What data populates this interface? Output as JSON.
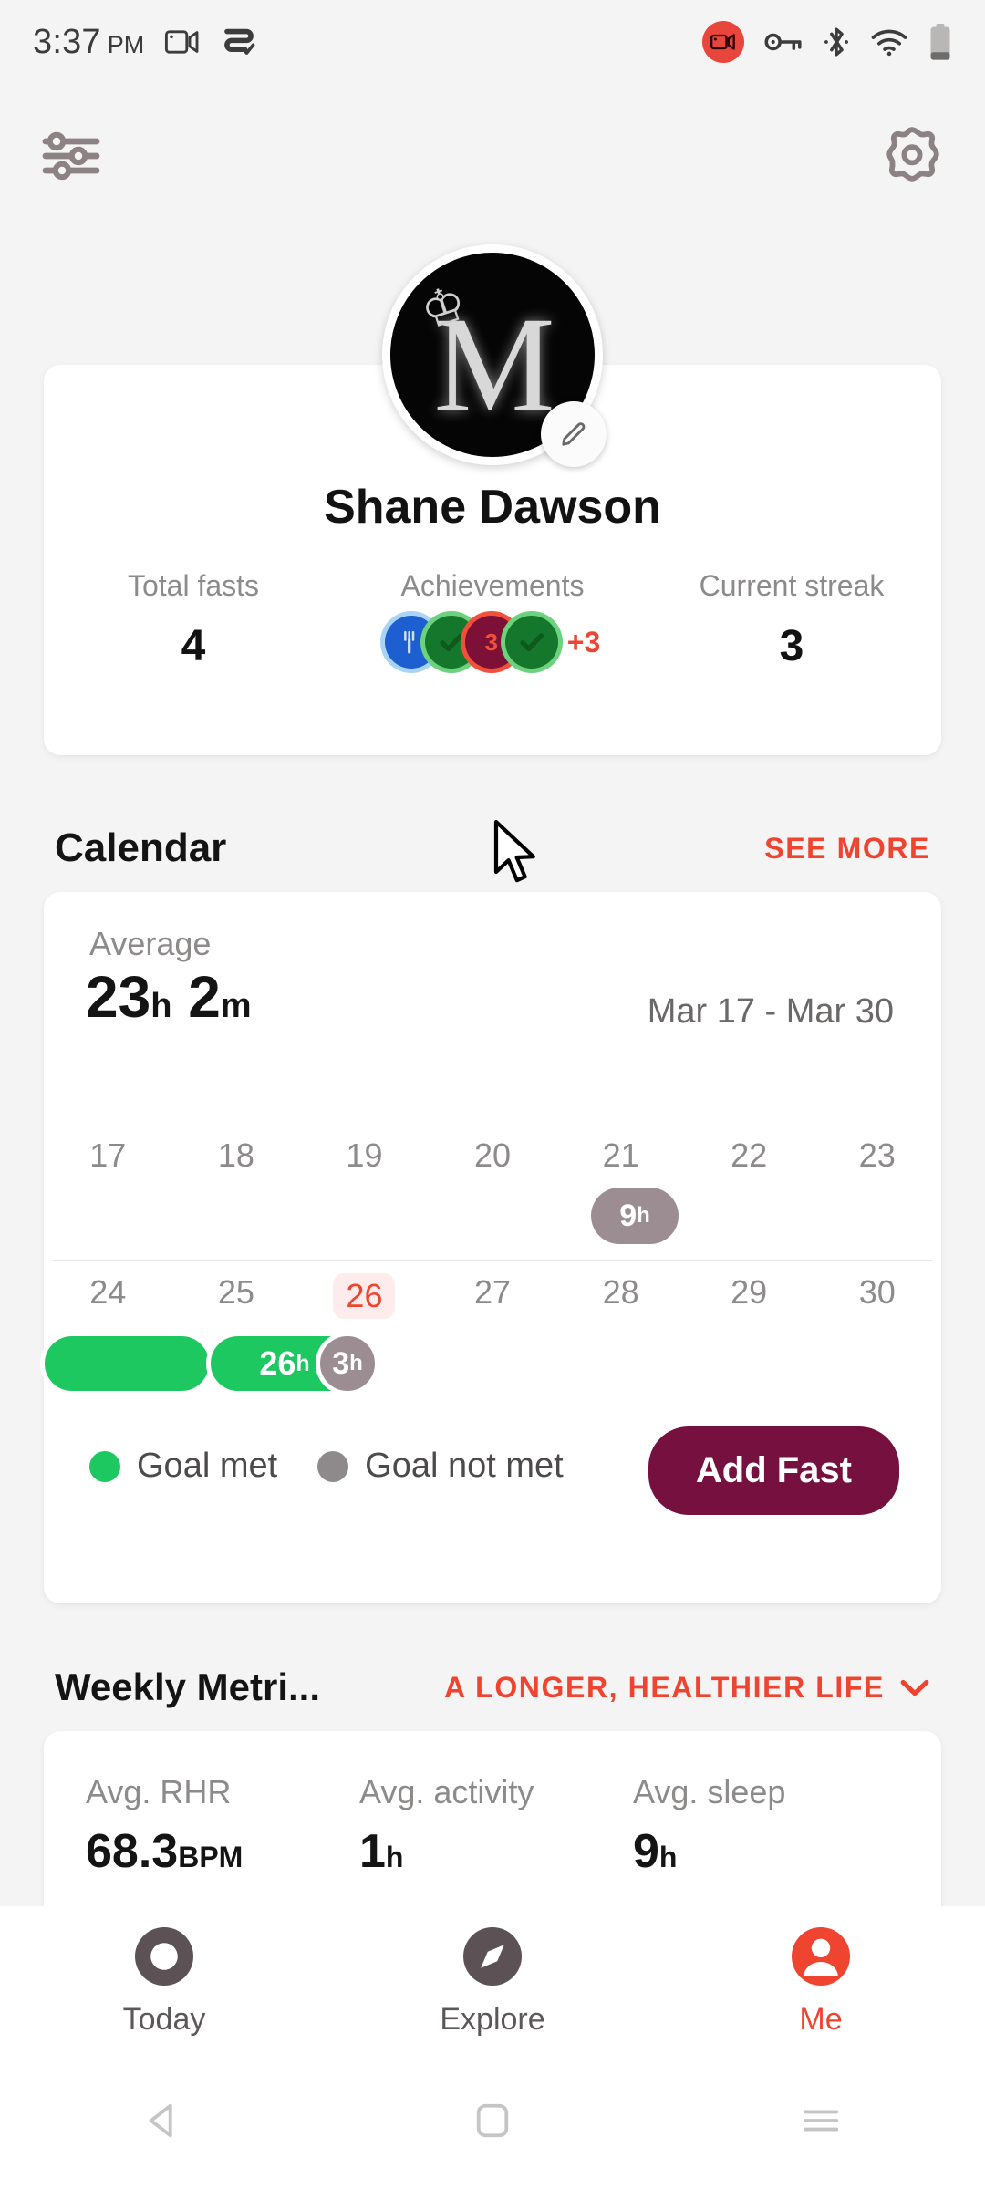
{
  "status_bar": {
    "time": "3:37",
    "ampm": "PM",
    "icons": [
      "screen-record-icon",
      "cast-icon",
      "screen-recording-badge",
      "vpn-key-icon",
      "bluetooth-icon",
      "wifi-icon",
      "battery-icon"
    ]
  },
  "app_bar": {
    "left_icon": "sliders-icon",
    "right_icon": "gear-icon"
  },
  "profile": {
    "avatar_letter": "M",
    "avatar_crown": "♔",
    "edit_icon": "pencil-icon",
    "name": "Shane Dawson",
    "stats": [
      {
        "label": "Total fasts",
        "value": "4"
      },
      {
        "label": "Achievements",
        "value": ""
      },
      {
        "label": "Current streak",
        "value": "3"
      }
    ],
    "achievements": {
      "badges": [
        {
          "icon": "fork-badge",
          "color": "#1d5fd0",
          "ring": "#a9d4f5",
          "text": ""
        },
        {
          "icon": "check-badge",
          "color": "#15772b",
          "ring": "#6dd27d",
          "text": ""
        },
        {
          "icon": "streak-badge",
          "color": "#7c1036",
          "ring": "#f1503a",
          "text": "3"
        },
        {
          "icon": "check-badge",
          "color": "#15772b",
          "ring": "#6dd27d",
          "text": ""
        }
      ],
      "more_label": "+3"
    }
  },
  "calendar_section": {
    "title": "Calendar",
    "see_more": "SEE MORE",
    "average_label": "Average",
    "average_hours": "23",
    "average_hours_unit": "h",
    "average_minutes": "2",
    "average_minutes_unit": "m",
    "date_range": "Mar 17 - Mar 30",
    "legend": [
      {
        "label": "Goal met",
        "color": "#1ec860"
      },
      {
        "label": "Goal not met",
        "color": "#8e8a8c"
      }
    ],
    "add_fast_label": "Add Fast",
    "rows": [
      {
        "days": [
          "17",
          "18",
          "19",
          "20",
          "21",
          "22",
          "23"
        ],
        "today_index": -1
      },
      {
        "days": [
          "24",
          "25",
          "26",
          "27",
          "28",
          "29",
          "30"
        ],
        "today_index": 2
      }
    ],
    "entries": {
      "row1": [
        {
          "day": "21",
          "value": "9",
          "unit": "h",
          "type": "goal-not-met"
        }
      ],
      "row2": [
        {
          "day": "24",
          "value": "",
          "unit": "",
          "type": "goal-met"
        },
        {
          "day": "25",
          "value": "26",
          "unit": "h",
          "type": "goal-met"
        },
        {
          "day": "26",
          "value": "3",
          "unit": "h",
          "type": "goal-not-met"
        }
      ]
    }
  },
  "weekly_metrics": {
    "title": "Weekly Metri...",
    "dropdown_label": "A LONGER, HEALTHIER LIFE",
    "dropdown_icon": "chevron-down-icon",
    "metrics": [
      {
        "label": "Avg. RHR",
        "value": "68.3",
        "unit": "BPM"
      },
      {
        "label": "Avg. activity",
        "value": "1",
        "unit": "h"
      },
      {
        "label": "Avg. sleep",
        "value": "9",
        "unit": "h"
      }
    ]
  },
  "bottom_nav": {
    "items": [
      {
        "label": "Today",
        "icon": "ring-icon",
        "active": false
      },
      {
        "label": "Explore",
        "icon": "compass-icon",
        "active": false
      },
      {
        "label": "Me",
        "icon": "person-icon",
        "active": true
      }
    ]
  },
  "system_nav": {
    "back": "back-triangle-icon",
    "home": "home-square-icon",
    "recents": "recents-menu-icon"
  },
  "colors": {
    "accent_red": "#ef4430",
    "green": "#1ec860",
    "grey": "#9c8d92",
    "maroon": "#75103f",
    "background": "#f5f4f4"
  }
}
